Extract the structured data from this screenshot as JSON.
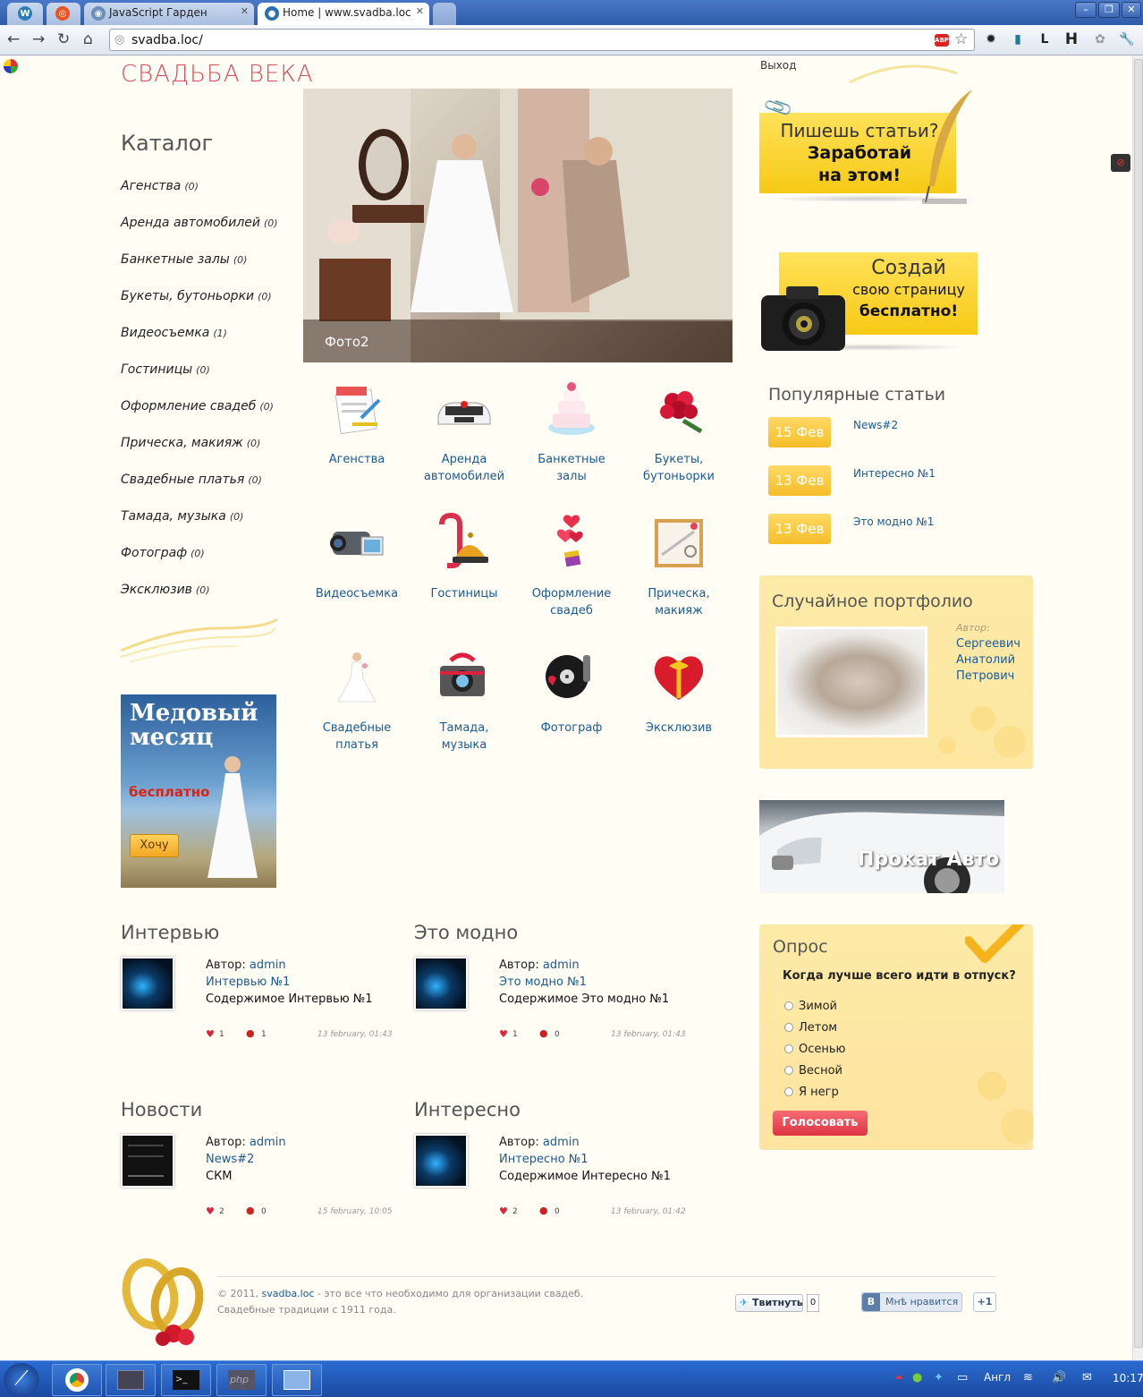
{
  "browser": {
    "tabs": [
      {
        "label": ""
      },
      {
        "label": ""
      },
      {
        "label": "JavaScript Гарден"
      },
      {
        "label": "Home | www.svadba.loc"
      }
    ],
    "url": "svadba.loc/"
  },
  "site": {
    "logo": "СВАДЬБА ВЕКА",
    "logout": "Выход"
  },
  "catalog": {
    "title": "Каталог",
    "items": [
      {
        "label": "Агенства",
        "count": "(0)"
      },
      {
        "label": "Аренда автомобилей",
        "count": "(0)"
      },
      {
        "label": "Банкетные залы",
        "count": "(0)"
      },
      {
        "label": "Букеты, бутоньорки",
        "count": "(0)"
      },
      {
        "label": "Видеосъемка",
        "count": "(1)"
      },
      {
        "label": "Гостиницы",
        "count": "(0)"
      },
      {
        "label": "Оформление свадеб",
        "count": "(0)"
      },
      {
        "label": "Прическа, макияж",
        "count": "(0)"
      },
      {
        "label": "Свадебные платья",
        "count": "(0)"
      },
      {
        "label": "Тамада, музыка",
        "count": "(0)"
      },
      {
        "label": "Фотограф",
        "count": "(0)"
      },
      {
        "label": "Эксклюзив",
        "count": "(0)"
      }
    ]
  },
  "honeymoon": {
    "line1": "Медовый",
    "line2": "месяц",
    "line3": "бесплатно",
    "button": "Хочу"
  },
  "slider": {
    "caption": "Фото2"
  },
  "grid": [
    {
      "l1": "Агенства",
      "l2": "",
      "icon": "document-icon"
    },
    {
      "l1": "Аренда",
      "l2": "автомобилей",
      "icon": "car-icon"
    },
    {
      "l1": "Банкетные",
      "l2": "залы",
      "icon": "cake-icon"
    },
    {
      "l1": "Букеты,",
      "l2": "бутоньорки",
      "icon": "bouquet-icon"
    },
    {
      "l1": "Видеосъемка",
      "l2": "",
      "icon": "camcorder-icon"
    },
    {
      "l1": "Гостиницы",
      "l2": "",
      "icon": "hotel-bell-icon"
    },
    {
      "l1": "Оформление",
      "l2": "свадеб",
      "icon": "balloons-icon"
    },
    {
      "l1": "Прическа,",
      "l2": "макияж",
      "icon": "mirror-icon"
    },
    {
      "l1": "Свадебные",
      "l2": "платья",
      "icon": "dress-icon"
    },
    {
      "l1": "Тамада,",
      "l2": "музыка",
      "icon": "gift-camera-icon"
    },
    {
      "l1": "Фотограф",
      "l2": "",
      "icon": "record-icon"
    },
    {
      "l1": "Эксклюзив",
      "l2": "",
      "icon": "heart-box-icon"
    }
  ],
  "posts": [
    {
      "section": "Интервью",
      "author_label": "Автор:",
      "author": "admin",
      "title": "Интервью №1",
      "body": "Содержимое Интервью №1",
      "likes": "1",
      "comments": "1",
      "date": "13 february, 01:43"
    },
    {
      "section": "Это модно",
      "author_label": "Автор:",
      "author": "admin",
      "title": "Это модно №1",
      "body": "Содержимое Это модно №1",
      "likes": "1",
      "comments": "0",
      "date": "13 february, 01:43"
    },
    {
      "section": "Новости",
      "author_label": "Автор:",
      "author": "admin",
      "title": "News#2",
      "body": "СКМ",
      "likes": "2",
      "comments": "0",
      "date": "15 february, 10:05"
    },
    {
      "section": "Интересно",
      "author_label": "Автор:",
      "author": "admin",
      "title": "Интересно №1",
      "body": "Содержимое Интересно №1",
      "likes": "2",
      "comments": "0",
      "date": "13 february, 01:42"
    }
  ],
  "promo1": {
    "l1": "Пишешь статьи?",
    "l2": "Заработай",
    "l3": "на этом!"
  },
  "promo2": {
    "l1": "Создай",
    "l2": "свою страницу",
    "l3": "бесплатно!"
  },
  "popular": {
    "title": "Популярные статьи",
    "items": [
      {
        "date": "15 Фев",
        "title": "News#2"
      },
      {
        "date": "13 Фев",
        "title": "Интересно №1"
      },
      {
        "date": "13 Фев",
        "title": "Это модно №1"
      }
    ]
  },
  "portfolio": {
    "title": "Случайное портфолио",
    "author_label": "Автор:",
    "n1": "Сергеевич",
    "n2": "Анатолий",
    "n3": "Петрович"
  },
  "auto": {
    "label": "Прокат Авто"
  },
  "poll": {
    "title": "Опрос",
    "question": "Когда лучше всего идти в отпуск?",
    "options": [
      "Зимой",
      "Летом",
      "Осенью",
      "Весной",
      "Я негр"
    ],
    "button": "Голосовать"
  },
  "footer": {
    "copy_prefix": "© 2011,",
    "site_link": "svadba.loc",
    "copy_suffix": "- это все что необходимо для организации свадеб.",
    "line2": "Свадебные традиции с 1911 года.",
    "tweet": "Твитнуть",
    "tweet_count": "0",
    "vk": "Мнѣ нравится",
    "vk_badge": "В",
    "plus": "+1"
  },
  "taskbar": {
    "lang": "Англ",
    "time": "10:17"
  }
}
